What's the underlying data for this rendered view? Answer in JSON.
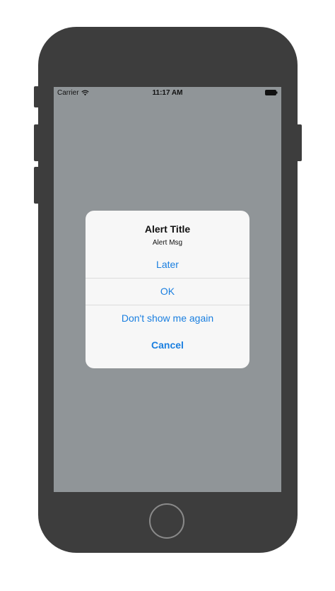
{
  "status_bar": {
    "carrier": "Carrier",
    "time": "11:17 AM",
    "wifi_icon": "wifi-icon",
    "battery_icon": "battery-icon"
  },
  "alert": {
    "title": "Alert Title",
    "message": "Alert Msg",
    "actions": [
      {
        "label": "Later",
        "style": "default"
      },
      {
        "label": "OK",
        "style": "default"
      },
      {
        "label": "Don't show me again",
        "style": "default"
      },
      {
        "label": "Cancel",
        "style": "cancel"
      }
    ]
  },
  "colors": {
    "device": "#3d3d3d",
    "dim_overlay": "#909598",
    "alert_background": "#f7f7f7",
    "action_tint": "#1a7fe0",
    "home_button_ring": "#8a8a8a"
  }
}
